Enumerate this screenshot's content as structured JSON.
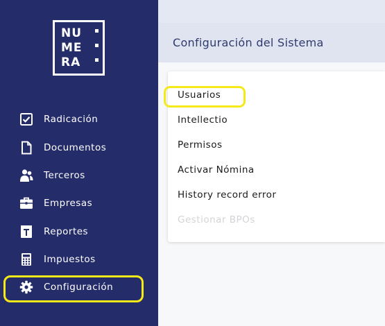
{
  "logo": {
    "row1": "NU",
    "row2": "ME",
    "row3": "RA"
  },
  "sidebar": {
    "items": [
      {
        "label": "Radicación",
        "icon": "checkbox-icon"
      },
      {
        "label": "Documentos",
        "icon": "document-icon"
      },
      {
        "label": "Terceros",
        "icon": "users-icon"
      },
      {
        "label": "Empresas",
        "icon": "briefcase-icon"
      },
      {
        "label": "Reportes",
        "icon": "report-icon"
      },
      {
        "label": "Impuestos",
        "icon": "calculator-icon"
      },
      {
        "label": "Configuración",
        "icon": "gear-icon"
      }
    ]
  },
  "header": {
    "title": "Configuración del Sistema"
  },
  "menu": {
    "items": [
      {
        "label": "Usuarios",
        "enabled": true
      },
      {
        "label": "Intellectio",
        "enabled": true
      },
      {
        "label": "Permisos",
        "enabled": true
      },
      {
        "label": "Activar Nómina",
        "enabled": true
      },
      {
        "label": "History record error",
        "enabled": true
      },
      {
        "label": "Gestionar BPOs",
        "enabled": false
      }
    ]
  },
  "colors": {
    "sidebar_bg": "#252c6a",
    "highlight": "#f5ea17",
    "header_bg": "#dfe4f0",
    "title_text": "#2f3a6e",
    "disabled_text": "#d4d4d8"
  }
}
